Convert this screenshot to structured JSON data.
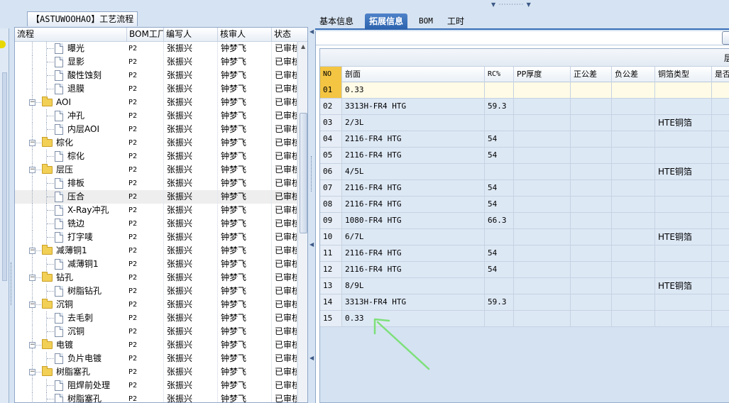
{
  "tree": {
    "panel_title_code": "【ASTUWOOHAO】",
    "panel_title_suffix": "工艺流程",
    "columns": [
      "流程",
      "BOM工厂",
      "编写人",
      "核审人",
      "状态"
    ],
    "rows": [
      {
        "type": "leaf",
        "name": "曝光",
        "bom": "P2",
        "writer": "张振兴",
        "reviewer": "钟梦飞",
        "status": "已审核"
      },
      {
        "type": "leaf",
        "name": "显影",
        "bom": "P2",
        "writer": "张振兴",
        "reviewer": "钟梦飞",
        "status": "已审核"
      },
      {
        "type": "leaf",
        "name": "酸性蚀刻",
        "bom": "P2",
        "writer": "张振兴",
        "reviewer": "钟梦飞",
        "status": "已审核"
      },
      {
        "type": "leaf",
        "name": "退膜",
        "bom": "P2",
        "writer": "张振兴",
        "reviewer": "钟梦飞",
        "status": "已审核"
      },
      {
        "type": "folder",
        "name": "AOI",
        "bom": "P2",
        "writer": "张振兴",
        "reviewer": "钟梦飞",
        "status": "已审核"
      },
      {
        "type": "leaf",
        "name": "冲孔",
        "bom": "P2",
        "writer": "张振兴",
        "reviewer": "钟梦飞",
        "status": "已审核"
      },
      {
        "type": "leaf",
        "name": "内层AOI",
        "bom": "P2",
        "writer": "张振兴",
        "reviewer": "钟梦飞",
        "status": "已审核"
      },
      {
        "type": "folder",
        "name": "棕化",
        "bom": "P2",
        "writer": "张振兴",
        "reviewer": "钟梦飞",
        "status": "已审核"
      },
      {
        "type": "leaf",
        "name": "棕化",
        "bom": "P2",
        "writer": "张振兴",
        "reviewer": "钟梦飞",
        "status": "已审核"
      },
      {
        "type": "folder",
        "name": "层压",
        "bom": "P2",
        "writer": "张振兴",
        "reviewer": "钟梦飞",
        "status": "已审核"
      },
      {
        "type": "leaf",
        "name": "排板",
        "bom": "P2",
        "writer": "张振兴",
        "reviewer": "钟梦飞",
        "status": "已审核"
      },
      {
        "type": "leaf",
        "name": "压合",
        "bom": "P2",
        "writer": "张振兴",
        "reviewer": "钟梦飞",
        "status": "已审核",
        "selected": true
      },
      {
        "type": "leaf",
        "name": "X-Ray冲孔",
        "bom": "P2",
        "writer": "张振兴",
        "reviewer": "钟梦飞",
        "status": "已审核"
      },
      {
        "type": "leaf",
        "name": "铣边",
        "bom": "P2",
        "writer": "张振兴",
        "reviewer": "钟梦飞",
        "status": "已审核"
      },
      {
        "type": "leaf",
        "name": "打字唛",
        "bom": "P2",
        "writer": "张振兴",
        "reviewer": "钟梦飞",
        "status": "已审核"
      },
      {
        "type": "folder",
        "name": "减薄铜1",
        "bom": "P2",
        "writer": "张振兴",
        "reviewer": "钟梦飞",
        "status": "已审核"
      },
      {
        "type": "leaf",
        "name": "减薄铜1",
        "bom": "P2",
        "writer": "张振兴",
        "reviewer": "钟梦飞",
        "status": "已审核"
      },
      {
        "type": "folder",
        "name": "钻孔",
        "bom": "P2",
        "writer": "张振兴",
        "reviewer": "钟梦飞",
        "status": "已审核"
      },
      {
        "type": "leaf",
        "name": "树脂钻孔",
        "bom": "P2",
        "writer": "张振兴",
        "reviewer": "钟梦飞",
        "status": "已审核"
      },
      {
        "type": "folder",
        "name": "沉铜",
        "bom": "P2",
        "writer": "张振兴",
        "reviewer": "钟梦飞",
        "status": "已审核"
      },
      {
        "type": "leaf",
        "name": "去毛刺",
        "bom": "P2",
        "writer": "张振兴",
        "reviewer": "钟梦飞",
        "status": "已审核"
      },
      {
        "type": "leaf",
        "name": "沉铜",
        "bom": "P2",
        "writer": "张振兴",
        "reviewer": "钟梦飞",
        "status": "已审核"
      },
      {
        "type": "folder",
        "name": "电镀",
        "bom": "P2",
        "writer": "张振兴",
        "reviewer": "钟梦飞",
        "status": "已审核"
      },
      {
        "type": "leaf",
        "name": "负片电镀",
        "bom": "P2",
        "writer": "张振兴",
        "reviewer": "钟梦飞",
        "status": "已审核"
      },
      {
        "type": "folder",
        "name": "树脂塞孔",
        "bom": "P2",
        "writer": "张振兴",
        "reviewer": "钟梦飞",
        "status": "已审核"
      },
      {
        "type": "leaf",
        "name": "阻焊前处理",
        "bom": "P2",
        "writer": "张振兴",
        "reviewer": "钟梦飞",
        "status": "已审核"
      },
      {
        "type": "leaf",
        "name": "树脂塞孔",
        "bom": "P2",
        "writer": "张振兴",
        "reviewer": "钟梦飞",
        "status": "已审核"
      }
    ]
  },
  "tabs": [
    {
      "label": "基本信息",
      "active": false
    },
    {
      "label": "拓展信息",
      "active": true
    },
    {
      "label": "BOM",
      "active": false
    },
    {
      "label": "工时",
      "active": false
    }
  ],
  "grid": {
    "top_label": "层",
    "columns": [
      "NO",
      "剖面",
      "RC%",
      "PP厚度",
      "正公差",
      "负公差",
      "铜箔类型",
      "是否"
    ],
    "rows": [
      {
        "no": "01",
        "section": "0.33",
        "rc": "",
        "pp": "",
        "pos": "",
        "neg": "",
        "cu": ""
      },
      {
        "no": "02",
        "section": "3313H-FR4 HTG",
        "rc": "59.3",
        "pp": "",
        "pos": "",
        "neg": "",
        "cu": ""
      },
      {
        "no": "03",
        "section": "2/3L",
        "rc": "",
        "pp": "",
        "pos": "",
        "neg": "",
        "cu": "HTE铜箔"
      },
      {
        "no": "04",
        "section": "2116-FR4 HTG",
        "rc": "54",
        "pp": "",
        "pos": "",
        "neg": "",
        "cu": ""
      },
      {
        "no": "05",
        "section": "2116-FR4 HTG",
        "rc": "54",
        "pp": "",
        "pos": "",
        "neg": "",
        "cu": ""
      },
      {
        "no": "06",
        "section": "4/5L",
        "rc": "",
        "pp": "",
        "pos": "",
        "neg": "",
        "cu": "HTE铜箔"
      },
      {
        "no": "07",
        "section": "2116-FR4 HTG",
        "rc": "54",
        "pp": "",
        "pos": "",
        "neg": "",
        "cu": ""
      },
      {
        "no": "08",
        "section": "2116-FR4 HTG",
        "rc": "54",
        "pp": "",
        "pos": "",
        "neg": "",
        "cu": ""
      },
      {
        "no": "09",
        "section": "1080-FR4 HTG",
        "rc": "66.3",
        "pp": "",
        "pos": "",
        "neg": "",
        "cu": ""
      },
      {
        "no": "10",
        "section": "6/7L",
        "rc": "",
        "pp": "",
        "pos": "",
        "neg": "",
        "cu": "HTE铜箔"
      },
      {
        "no": "11",
        "section": "2116-FR4 HTG",
        "rc": "54",
        "pp": "",
        "pos": "",
        "neg": "",
        "cu": ""
      },
      {
        "no": "12",
        "section": "2116-FR4 HTG",
        "rc": "54",
        "pp": "",
        "pos": "",
        "neg": "",
        "cu": ""
      },
      {
        "no": "13",
        "section": "8/9L",
        "rc": "",
        "pp": "",
        "pos": "",
        "neg": "",
        "cu": "HTE铜箔"
      },
      {
        "no": "14",
        "section": "3313H-FR4 HTG",
        "rc": "59.3",
        "pp": "",
        "pos": "",
        "neg": "",
        "cu": ""
      },
      {
        "no": "15",
        "section": "0.33",
        "rc": "",
        "pp": "",
        "pos": "",
        "neg": "",
        "cu": ""
      }
    ]
  },
  "colors": {
    "accent": "#2c62ad",
    "row_bg": "#dde8f5",
    "header_highlight": "#f4c542",
    "annotation_arrow": "#7ee07a"
  },
  "icons": {
    "folder": "folder-icon",
    "document": "document-icon",
    "expander": "collapse-icon"
  }
}
